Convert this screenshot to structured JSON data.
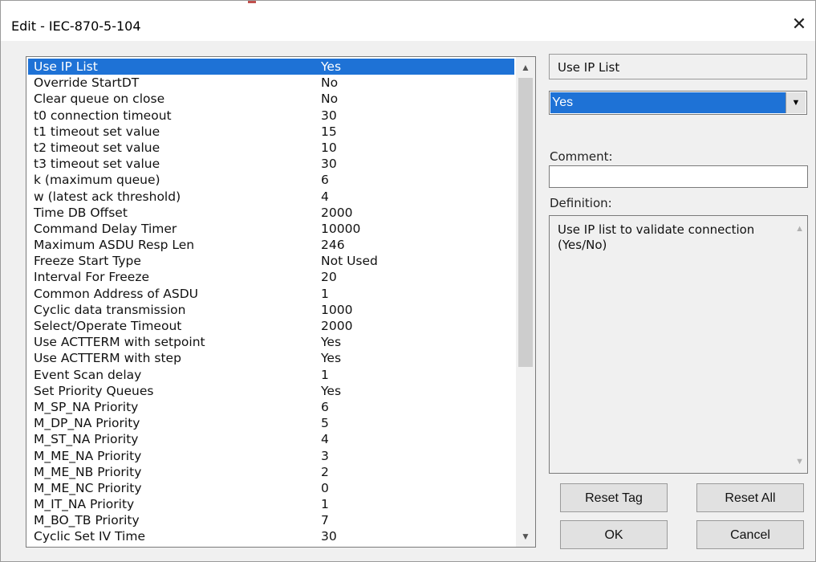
{
  "window": {
    "title": "Edit - IEC-870-5-104",
    "close_glyph": "✕"
  },
  "properties": [
    {
      "name": "Use IP List",
      "value": "Yes"
    },
    {
      "name": "Override StartDT",
      "value": "No"
    },
    {
      "name": "Clear queue on close",
      "value": "No"
    },
    {
      "name": "t0 connection timeout",
      "value": "30"
    },
    {
      "name": "t1 timeout set value",
      "value": "15"
    },
    {
      "name": "t2 timeout set value",
      "value": "10"
    },
    {
      "name": "t3 timeout set value",
      "value": "30"
    },
    {
      "name": "k (maximum queue)",
      "value": "6"
    },
    {
      "name": "w (latest ack threshold)",
      "value": "4"
    },
    {
      "name": "Time DB Offset",
      "value": "2000"
    },
    {
      "name": "Command Delay Timer",
      "value": "10000"
    },
    {
      "name": "Maximum ASDU Resp Len",
      "value": "246"
    },
    {
      "name": "Freeze Start Type",
      "value": "Not Used"
    },
    {
      "name": "Interval For Freeze",
      "value": "20"
    },
    {
      "name": "Common Address of ASDU",
      "value": "1"
    },
    {
      "name": "Cyclic data transmission",
      "value": "1000"
    },
    {
      "name": "Select/Operate Timeout",
      "value": "2000"
    },
    {
      "name": "Use ACTTERM with setpoint",
      "value": "Yes"
    },
    {
      "name": "Use ACTTERM with step",
      "value": "Yes"
    },
    {
      "name": "Event Scan delay",
      "value": "1"
    },
    {
      "name": "Set Priority Queues",
      "value": "Yes"
    },
    {
      "name": "M_SP_NA Priority",
      "value": "6"
    },
    {
      "name": "M_DP_NA Priority",
      "value": "5"
    },
    {
      "name": "M_ST_NA Priority",
      "value": "4"
    },
    {
      "name": "M_ME_NA Priority",
      "value": "3"
    },
    {
      "name": "M_ME_NB Priority",
      "value": "2"
    },
    {
      "name": "M_ME_NC Priority",
      "value": "0"
    },
    {
      "name": "M_IT_NA Priority",
      "value": "1"
    },
    {
      "name": "M_BO_TB Priority",
      "value": "7"
    },
    {
      "name": "Cyclic Set IV Time",
      "value": "30"
    }
  ],
  "selected_index": 0,
  "editor": {
    "field_name": "Use IP List",
    "selected_value": "Yes",
    "comment_label": "Comment:",
    "comment_value": "",
    "definition_label": "Definition:",
    "definition_text": "Use IP list to validate connection (Yes/No)"
  },
  "buttons": {
    "reset_tag": "Reset Tag",
    "reset_all": "Reset All",
    "ok": "OK",
    "cancel": "Cancel"
  },
  "colors": {
    "selection": "#1e72d6"
  }
}
